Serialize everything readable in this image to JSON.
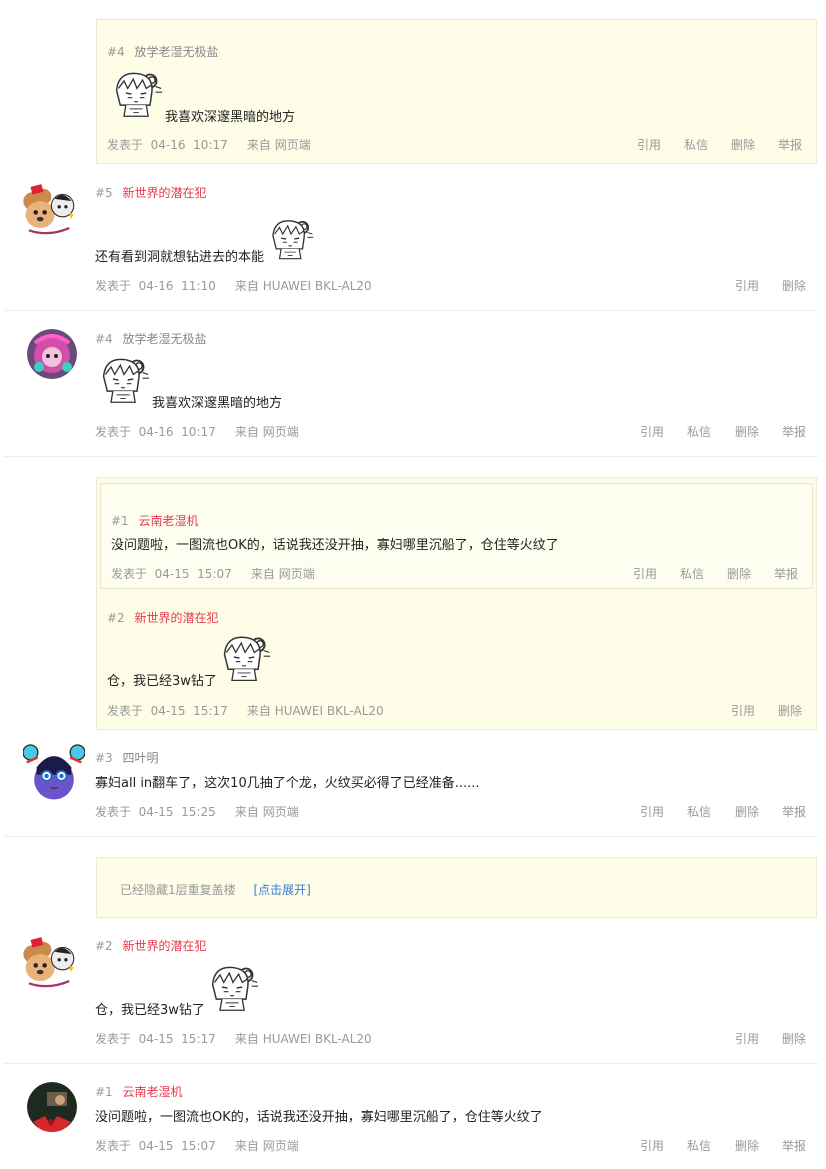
{
  "posts": [
    {
      "quote": {
        "floor": "#4",
        "user": "放学老湿无极盐",
        "text": "我喜欢深邃黑暗的地方",
        "posted_label": "发表于",
        "date": "04-16",
        "time": "10:17",
        "from_label": "来自",
        "source": "网页端",
        "actions": [
          "引用",
          "私信",
          "删除",
          "举报"
        ]
      }
    },
    {
      "floor": "#5",
      "user": "新世界的潜在犯",
      "text": "还有看到洞就想钻进去的本能",
      "posted_label": "发表于",
      "date": "04-16",
      "time": "11:10",
      "from_label": "来自",
      "source": "HUAWEI  BKL-AL20",
      "actions": [
        "引用",
        "删除"
      ]
    },
    {
      "floor": "#4",
      "user": "放学老湿无极盐",
      "text": "我喜欢深邃黑暗的地方",
      "posted_label": "发表于",
      "date": "04-16",
      "time": "10:17",
      "from_label": "来自",
      "source": "网页端",
      "actions": [
        "引用",
        "私信",
        "删除",
        "举报"
      ]
    },
    {
      "quote_outer": {
        "inner": {
          "floor": "#1",
          "user": "云南老湿机",
          "text": "没问题啦，一图流也OK的，话说我还没开抽，寡妇哪里沉船了，仓住等火纹了",
          "posted_label": "发表于",
          "date": "04-15",
          "time": "15:07",
          "from_label": "来自",
          "source": "网页端",
          "actions": [
            "引用",
            "私信",
            "删除",
            "举报"
          ]
        },
        "floor": "#2",
        "user": "新世界的潜在犯",
        "text": "仓，我已经3w钻了",
        "posted_label": "发表于",
        "date": "04-15",
        "time": "15:17",
        "from_label": "来自",
        "source": "HUAWEI  BKL-AL20",
        "actions": [
          "引用",
          "删除"
        ]
      },
      "floor": "#3",
      "user": "四叶明",
      "text": "寡妇all  in翻车了，这次10几抽了个龙，火纹买必得了已经准备......",
      "posted_label": "发表于",
      "date": "04-15",
      "time": "15:25",
      "from_label": "来自",
      "source": "网页端",
      "actions": [
        "引用",
        "私信",
        "删除",
        "举报"
      ]
    },
    {
      "hidden_notice": "已经隐藏1层重复盖楼",
      "expand_link": "[点击展开]",
      "floor": "#2",
      "user": "新世界的潜在犯",
      "text": "仓，我已经3w钻了",
      "posted_label": "发表于",
      "date": "04-15",
      "time": "15:17",
      "from_label": "来自",
      "source": "HUAWEI  BKL-AL20",
      "actions": [
        "引用",
        "删除"
      ]
    },
    {
      "floor": "#1",
      "user": "云南老湿机",
      "text": "没问题啦，一图流也OK的，话说我还没开抽，寡妇哪里沉船了，仓住等火纹了",
      "posted_label": "发表于",
      "date": "04-15",
      "time": "15:07",
      "from_label": "来自",
      "source": "网页端",
      "actions": [
        "引用",
        "私信",
        "删除",
        "举报"
      ]
    }
  ],
  "colors": {
    "quote_bg": "#fdfde8",
    "username_red": "#e8384b",
    "meta_gray": "#999999",
    "link_blue": "#3a7bd5"
  }
}
